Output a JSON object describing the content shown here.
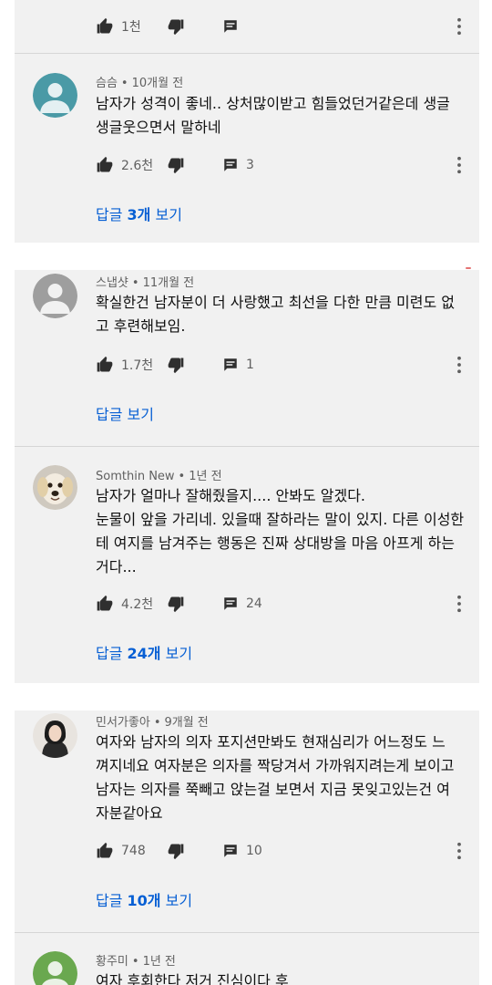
{
  "comments": [
    {
      "author": "",
      "time": "",
      "lines": [],
      "likes": "1천",
      "replies_count": "",
      "view_replies": ""
    },
    {
      "author": "슴슴",
      "time": "10개월 전",
      "lines": [
        "남자가 성격이 좋네.. 상처많이받고 힘들었던거같은데 생글",
        "생글웃으면서 말하네"
      ],
      "likes": "2.6천",
      "replies_count": "3",
      "view_replies": "답글 3개 보기"
    },
    {
      "author": "스냅샷",
      "time": "11개월 전",
      "lines": [
        "확실한건 남자분이 더 사랑했고 최선을 다한 만큼 미련도 없",
        "고 후련해보임."
      ],
      "likes": "1.7천",
      "replies_count": "1",
      "view_replies": "답글 보기"
    },
    {
      "author": "Somthin New",
      "time": "1년 전",
      "lines": [
        "남자가 얼마나 잘해줬을지.... 안봐도 알겠다.",
        "눈물이 앞을 가리네. 있을때 잘하라는 말이 있지. 다른 이성한",
        "테 여지를 남겨주는 행동은 진짜 상대방을 마음 아프게 하는",
        "거다..."
      ],
      "likes": "4.2천",
      "replies_count": "24",
      "view_replies": "답글 24개 보기"
    },
    {
      "author": "민서가좋아",
      "time": "9개월 전",
      "lines": [
        "여자와 남자의 의자 포지션만봐도  현재심리가 어느정도 느",
        "껴지네요 여자분은 의자를 짝당겨서 가까워지려는게 보이고",
        "남자는 의자를 쭉빼고 앉는걸 보면서 지금 못잊고있는건 여",
        "자분같아요"
      ],
      "likes": "748",
      "replies_count": "10",
      "view_replies": "답글 10개 보기"
    },
    {
      "author": "황주미",
      "time": "1년 전",
      "lines": [
        "여자 후회한다 저거 진심이다 후"
      ],
      "likes": "",
      "replies_count": "",
      "view_replies": ""
    }
  ],
  "separator": "•",
  "icons": {
    "like": "thumb-up-icon",
    "dislike": "thumb-down-icon",
    "reply": "comment-icon",
    "more": "more-vert-icon",
    "avatar": "default-avatar-icon"
  },
  "colors": {
    "card_background": "#f1f1f1",
    "link_blue": "#065fd4",
    "meta_gray": "#606060",
    "icon_dark": "#2f2f2f",
    "default_avatar_teal": "#4a9aa6",
    "default_avatar_gray": "#9e9e9e",
    "default_avatar_green": "#6aa84f"
  }
}
